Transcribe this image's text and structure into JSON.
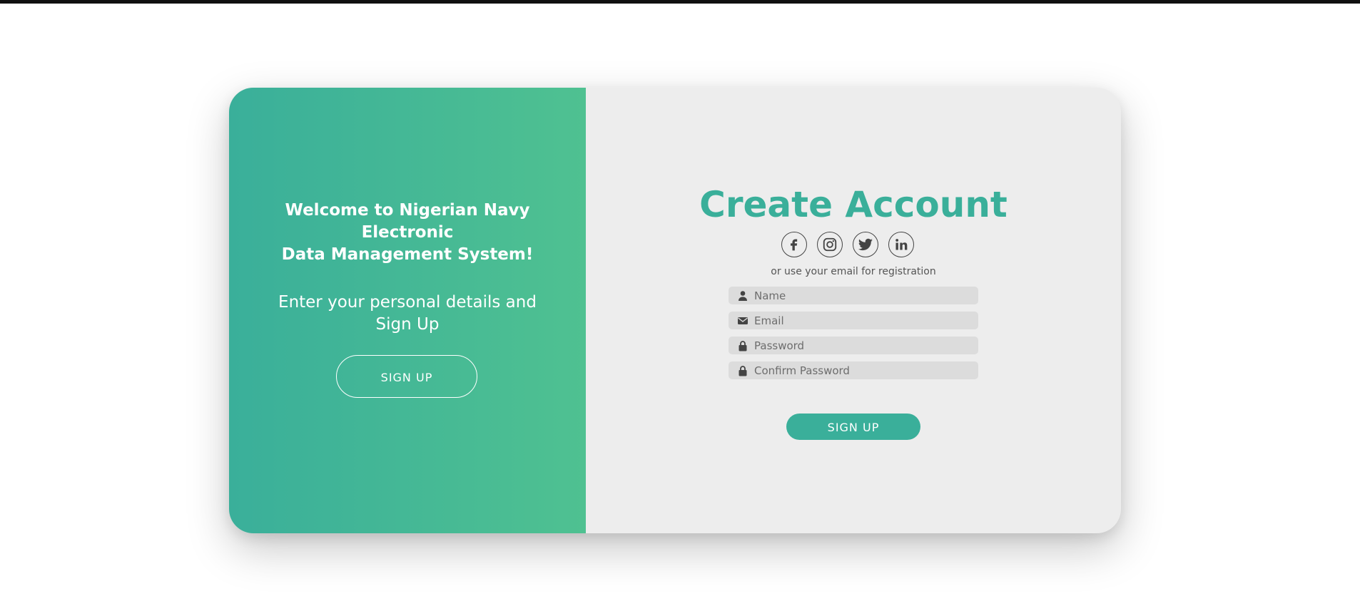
{
  "welcome_panel": {
    "heading_lines": [
      "Welcome to Nigerian Navy",
      "Electronic",
      "Data Management System!"
    ],
    "subtext_lines": [
      "Enter your personal details and",
      "Sign Up"
    ],
    "button_label": "SIGN UP"
  },
  "form": {
    "title": "Create Account",
    "social_icons": [
      "facebook-icon",
      "instagram-icon",
      "twitter-icon",
      "linkedin-icon"
    ],
    "hint": "or use your email for registration",
    "fields": [
      {
        "icon": "user-icon",
        "placeholder": "Name"
      },
      {
        "icon": "envelope-icon",
        "placeholder": "Email"
      },
      {
        "icon": "lock-icon",
        "placeholder": "Password"
      },
      {
        "icon": "lock-icon",
        "placeholder": "Confirm Password"
      }
    ],
    "submit_label": "SIGN UP"
  },
  "colors": {
    "accent": "#3aaf9a",
    "gradient_start": "#3aaf9a",
    "gradient_end": "#4fc191",
    "form_background": "#ededed",
    "field_background": "#dcdcdc"
  }
}
